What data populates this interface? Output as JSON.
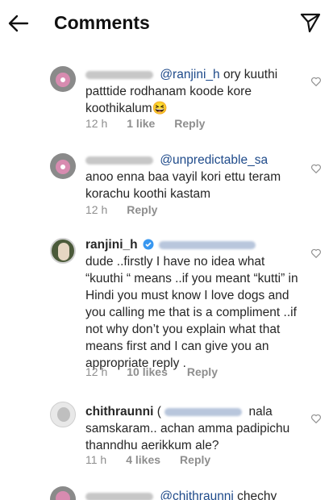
{
  "header": {
    "title": "Comments"
  },
  "comments": [
    {
      "mention": "@ranjini_h",
      "text": " ory kuuthi patttide rodhanam koode kore koothikalum😆",
      "time": "12 h",
      "likes": "1 like",
      "reply": "Reply"
    },
    {
      "mention": "@unpredictable_sa",
      "text": "anoo enna baa vayil kori ettu teram korachu koothi kastam",
      "time": "12 h",
      "reply": "Reply"
    },
    {
      "username": "ranjini_h",
      "text": "dude ..firstly I have no idea what “kuuthi “ means ..if you meant “kutti” in Hindi you must know I love dogs and you calling me that is a compliment ..if not why don’t you explain what that means first and I can give you an appropriate reply .",
      "time": "12 h",
      "likes": "10 likes",
      "reply": "Reply"
    },
    {
      "username": "chithraunni",
      "paren": "(",
      "text": "nala samskaram.. achan amma padipichu thanndhu aerikkum ale?",
      "time": "11 h",
      "likes": "4 likes",
      "reply": "Reply"
    },
    {
      "mention": "@chithraunni",
      "text": " chechy"
    }
  ],
  "colors": {
    "mention": "#1e4a8a",
    "meta": "#8e8e8e"
  }
}
